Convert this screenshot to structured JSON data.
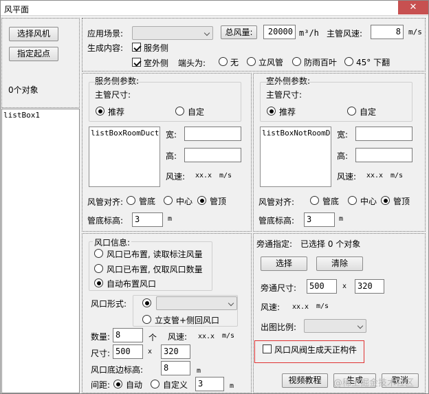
{
  "window": {
    "title": "风平面",
    "close": "✕"
  },
  "left": {
    "select_fan": "选择风机",
    "set_start": "指定起点",
    "object_count": "0个对象",
    "listbox": "listBox1"
  },
  "top": {
    "scene_label": "应用场景:",
    "total_air_btn": "总风量:",
    "total_air_value": "20000",
    "air_unit": "m³/h",
    "main_speed_label": "主管风速:",
    "main_speed_value": "8",
    "speed_unit": "m/s",
    "gen_content_label": "生成内容:",
    "service_side": "服务侧",
    "outdoor_side": "室外侧",
    "end_label": "端头为:",
    "end_none": "无",
    "end_riser": "立风管",
    "end_louver": "防雨百叶",
    "end_45": "45° 下翻"
  },
  "service": {
    "title": "服务侧参数:",
    "main_size": "主管尺寸:",
    "recommend": "推荐",
    "custom": "自定",
    "listbox": "listBoxRoomDuctSi",
    "width": "宽:",
    "height": "高:",
    "speed_label": "风速:",
    "speed_value": "xx.x",
    "speed_unit": "m/s",
    "align_label": "风管对齐:",
    "align_bottom": "管底",
    "align_center": "中心",
    "align_top": "管顶",
    "elev_label": "管底标高:",
    "elev_value": "3",
    "elev_unit": "m"
  },
  "outdoor": {
    "title": "室外侧参数:",
    "main_size": "主管尺寸:",
    "recommend": "推荐",
    "custom": "自定",
    "listbox": "listBoxNotRoomDuct",
    "width": "宽:",
    "height": "高:",
    "speed_label": "风速:",
    "speed_value": "xx.x",
    "speed_unit": "m/s",
    "align_label": "风管对齐:",
    "align_bottom": "管底",
    "align_center": "中心",
    "align_top": "管顶",
    "elev_label": "管底标高:",
    "elev_value": "3",
    "elev_unit": "m"
  },
  "outlet": {
    "info_title": "风口信息:",
    "opt_read_annot": "风口已布置, 读取标注风量",
    "opt_read_count": "风口已布置, 仅取风口数量",
    "opt_auto": "自动布置风口",
    "form_label": "风口形式:",
    "form_side": "立支管+侧回风口",
    "count_label": "数量:",
    "count_value": "8",
    "count_unit": "个",
    "speed_label": "风速:",
    "speed_value": "xx.x",
    "speed_unit": "m/s",
    "size_label": "尺寸:",
    "size_w": "500",
    "size_x": "x",
    "size_h": "320",
    "elev_label": "风口底边标高:",
    "elev_value": "8",
    "elev_unit": "m",
    "spacing_label": "间距:",
    "spacing_auto": "自动",
    "spacing_custom": "自定义",
    "spacing_value": "3",
    "spacing_unit": "m"
  },
  "bypass": {
    "label": "旁通指定:",
    "selected": "已选择 0 个对象",
    "select_btn": "选择",
    "clear_btn": "清除",
    "size_label": "旁通尺寸:",
    "size_w": "500",
    "size_x": "x",
    "size_h": "320",
    "speed_label": "风速:",
    "speed_value": "xx.x",
    "speed_unit": "m/s",
    "scale_label": "出图比例:",
    "valve_check": "风口风阀生成天正构件",
    "video_btn": "视频教程",
    "generate_btn": "生成",
    "cancel_btn": "取消",
    "watermark": "@稀土掘金技术社区"
  }
}
